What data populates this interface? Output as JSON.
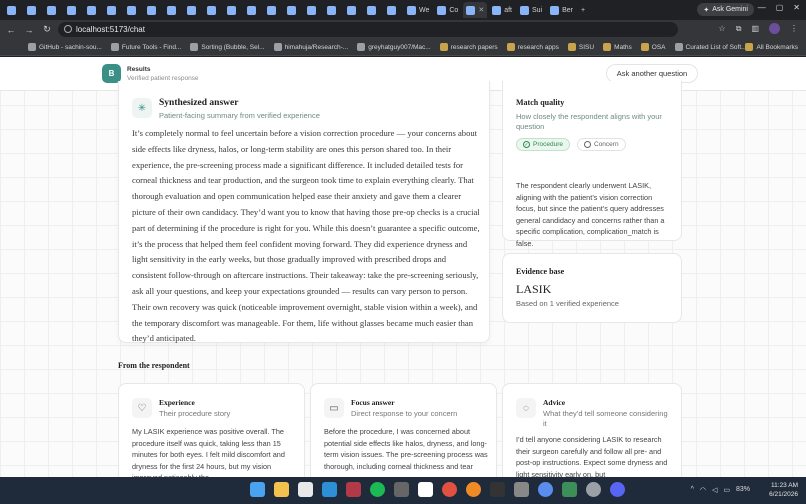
{
  "browser": {
    "tabs": [
      {
        "label": "",
        "icon": "github-icon"
      },
      {
        "label": "",
        "icon": "globe-icon"
      },
      {
        "label": "",
        "icon": "globe-icon"
      },
      {
        "label": "",
        "icon": "globe-icon"
      },
      {
        "label": "",
        "icon": "app-icon"
      },
      {
        "label": "",
        "icon": "app-icon"
      },
      {
        "label": "",
        "icon": "app-icon"
      },
      {
        "label": "",
        "icon": "app-icon"
      },
      {
        "label": "",
        "icon": "app-icon"
      },
      {
        "label": "",
        "icon": "app-icon"
      },
      {
        "label": "",
        "icon": "app-icon"
      },
      {
        "label": "",
        "icon": "app-icon"
      },
      {
        "label": "",
        "icon": "app-icon"
      },
      {
        "label": "",
        "icon": "app-icon"
      },
      {
        "label": "",
        "icon": "app-icon"
      },
      {
        "label": "",
        "icon": "app-icon"
      },
      {
        "label": "",
        "icon": "app-icon"
      },
      {
        "label": "",
        "icon": "app-icon"
      },
      {
        "label": "",
        "icon": "app-icon"
      },
      {
        "label": "",
        "icon": "app-icon"
      },
      {
        "label": "We",
        "icon": "app-icon"
      },
      {
        "label": "Co",
        "icon": "app-icon"
      },
      {
        "label": "",
        "icon": "app-icon",
        "active": true
      },
      {
        "label": "aft",
        "icon": "app-icon"
      },
      {
        "label": "Sui",
        "icon": "app-icon"
      },
      {
        "label": "Ber",
        "icon": "app-icon"
      }
    ],
    "new_tab": "+",
    "gemini_label": "Ask Gemini",
    "url": "localhost:5173/chat",
    "bookmarks": [
      {
        "label": "GitHub - sachin-sou...",
        "folder": false
      },
      {
        "label": "Future Tools - Find...",
        "folder": false
      },
      {
        "label": "Sorting (Bubble, Sel...",
        "folder": false
      },
      {
        "label": "himahuja/Research-...",
        "folder": false
      },
      {
        "label": "greyhatguy007/Mac...",
        "folder": false
      },
      {
        "label": "research papers",
        "folder": true
      },
      {
        "label": "research apps",
        "folder": true
      },
      {
        "label": "SISU",
        "folder": true
      },
      {
        "label": "Maths",
        "folder": true
      },
      {
        "label": "OSA",
        "folder": true
      },
      {
        "label": "Curated List of Soft...",
        "folder": false
      }
    ],
    "all_bookmarks": "All Bookmarks"
  },
  "header": {
    "logo_letter": "B",
    "title": "Results",
    "subtitle": "Verified patient response",
    "ask_button": "Ask another question"
  },
  "synth": {
    "title": "Synthesized answer",
    "subtitle": "Patient-facing summary from verified experience",
    "body": "It’s completely normal to feel uncertain before a vision correction procedure — your concerns about side effects like dryness, halos, or long-term stability are ones this person shared too. In their experience, the pre-screening process made a significant difference. It included detailed tests for corneal thickness and tear production, and the surgeon took time to explain everything clearly. That thorough evaluation and open communication helped ease their anxiety and gave them a clearer picture of their own candidacy. They’d want you to know that having those pre-op checks is a crucial part of determining if the procedure is right for you. While this doesn’t guarantee a specific outcome, it’s the process that helped them feel confident moving forward. They did experience dryness and light sensitivity in the early weeks, but those gradually improved with prescribed drops and consistent follow-through on aftercare instructions. Their takeaway: take the pre-screening seriously, ask all your questions, and keep your expectations grounded — results can vary person to person. Their own recovery was quick (noticeable improvement overnight, stable vision within a week), and the temporary discomfort was manageable. For them, life without glasses became much easier than they’d anticipated."
  },
  "match": {
    "title": "Match quality",
    "subtitle": "How closely the respondent aligns with your question",
    "pills": [
      {
        "label": "Procedure",
        "state": "matched"
      },
      {
        "label": "Concern",
        "state": "unmatched"
      }
    ],
    "body": "The respondent clearly underwent LASIK, aligning with the patient’s vision correction focus, but since the patient’s query addresses general candidacy and concerns rather than a specific complication, complication_match is false."
  },
  "evidence": {
    "title": "Evidence base",
    "value": "LASIK",
    "note": "Based on 1 verified experience"
  },
  "respondent": {
    "section_title": "From the respondent",
    "cards": [
      {
        "icon": "heart-pulse-icon",
        "title": "Experience",
        "subtitle": "Their procedure story",
        "body": "My LASIK experience was positive overall. The procedure itself was quick, taking less than 15 minutes for both eyes. I felt mild discomfort and dryness for the first 24 hours, but my vision improved noticeably the"
      },
      {
        "icon": "message-icon",
        "title": "Focus answer",
        "subtitle": "Direct response to your concern",
        "body": "Before the procedure, I was concerned about potential side effects like halos, dryness, and long-term vision issues. The pre-screening process was thorough, including corneal thickness and tear"
      },
      {
        "icon": "lightbulb-icon",
        "title": "Advice",
        "subtitle": "What they’d tell someone considering it",
        "body": "I’d tell anyone considering LASIK to research their surgeon carefully and follow all pre- and post-op instructions. Expect some dryness and light sensitivity early on, but"
      }
    ]
  },
  "taskbar": {
    "battery": "83%",
    "time": "11:23 AM",
    "date": "6/21/2026"
  },
  "colors": {
    "accent": "#3a8f86",
    "pill_match": "#2f8a4f",
    "page_bg": "#fafbfa"
  }
}
